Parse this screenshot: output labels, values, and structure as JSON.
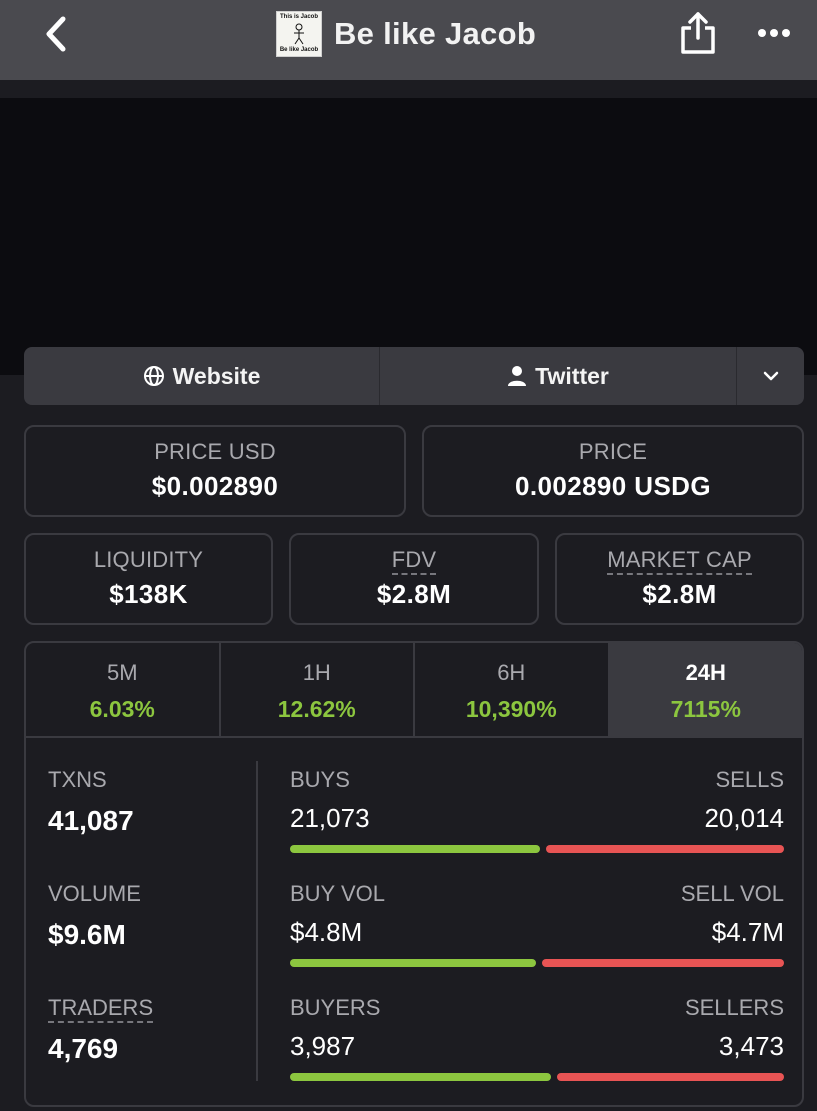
{
  "header": {
    "title": "Be like Jacob",
    "thumb_top": "This is Jacob",
    "thumb_bottom": "Be like Jacob"
  },
  "links": {
    "website": "Website",
    "twitter": "Twitter"
  },
  "prices": {
    "price_usd_label": "PRICE USD",
    "price_usd_value": "$0.002890",
    "price_label": "PRICE",
    "price_value": "0.002890 USDG"
  },
  "market": {
    "liquidity_label": "LIQUIDITY",
    "liquidity_value": "$138K",
    "fdv_label": "FDV",
    "fdv_value": "$2.8M",
    "mcap_label": "MARKET CAP",
    "mcap_value": "$2.8M"
  },
  "tabs": [
    {
      "label": "5M",
      "change": "6.03%"
    },
    {
      "label": "1H",
      "change": "12.62%"
    },
    {
      "label": "6H",
      "change": "10,390%"
    },
    {
      "label": "24H",
      "change": "7115%",
      "active": true
    }
  ],
  "stats": {
    "txns_label": "TXNS",
    "txns_value": "41,087",
    "volume_label": "VOLUME",
    "volume_value": "$9.6M",
    "traders_label": "TRADERS",
    "traders_value": "4,769",
    "buys_label": "BUYS",
    "buys_value": "21,073",
    "sells_label": "SELLS",
    "sells_value": "20,014",
    "buy_vol_label": "BUY VOL",
    "buy_vol_value": "$4.8M",
    "sell_vol_label": "SELL VOL",
    "sell_vol_value": "$4.7M",
    "buyers_label": "BUYERS",
    "buyers_value": "3,987",
    "sellers_label": "SELLERS",
    "sellers_value": "3,473"
  },
  "ratios": {
    "buys_share": 0.513,
    "buy_vol_share": 0.505,
    "buyers_share": 0.534
  },
  "colors": {
    "positive": "#8cc63f",
    "negative": "#e85454",
    "topbar": "#4a4a4f",
    "background": "#1c1c21"
  }
}
